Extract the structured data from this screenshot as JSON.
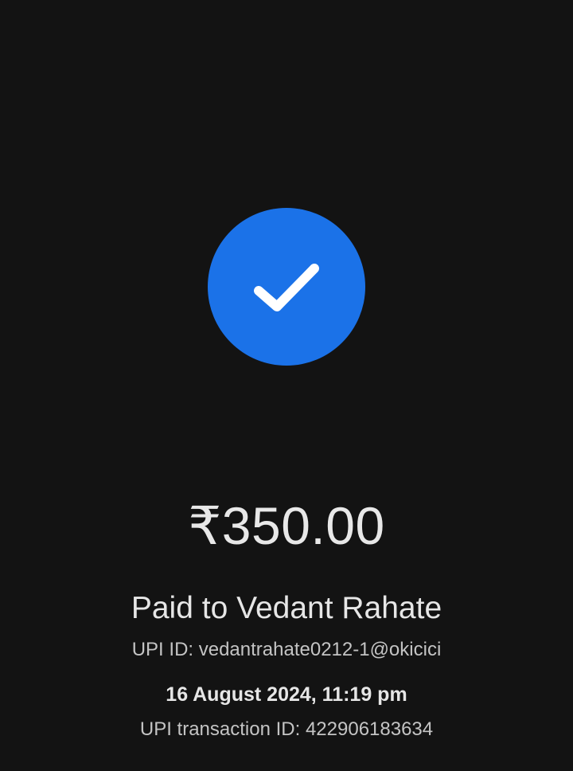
{
  "status": {
    "icon": "check-icon",
    "accent_color": "#1b72e8"
  },
  "payment": {
    "amount": "₹350.00",
    "paid_to": "Paid to Vedant Rahate",
    "upi_id": "UPI ID: vedantrahate0212-1@okicici",
    "datetime": "16 August 2024, 11:19 pm",
    "transaction_id": "UPI transaction ID: 422906183634"
  }
}
